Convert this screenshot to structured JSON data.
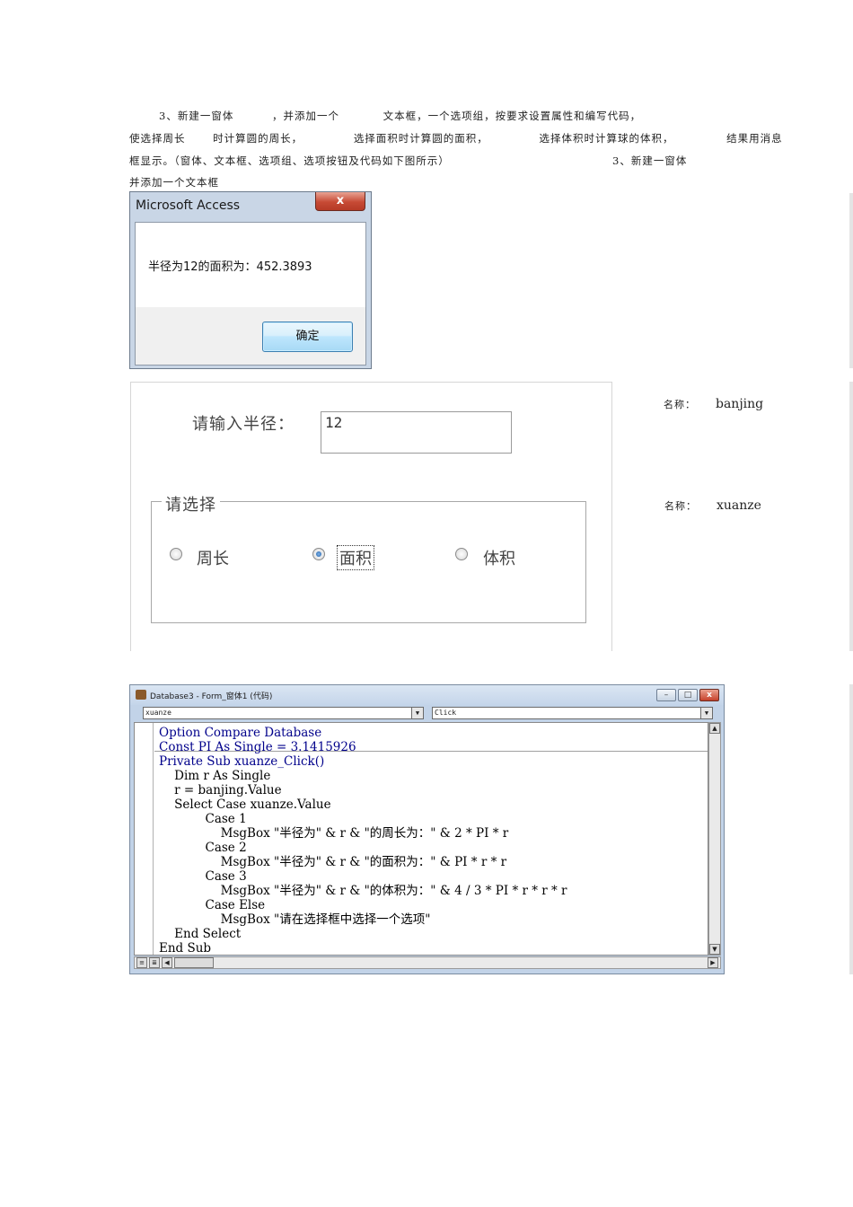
{
  "intro": {
    "line1": [
      "3、新建一窗体",
      "，并添加一个",
      "文本框，一个选项组，按要求设置属性和编写代码，"
    ],
    "line2": [
      "使选择周长",
      "时计算圆的周长，",
      "选择面积时计算圆的面积，",
      "选择体积时计算球的体积，",
      "结果用消息"
    ],
    "line3": [
      "框显示。（窗体、文本框、选项组、选项按钮及代码如下图所示）",
      "3、新建一窗体"
    ],
    "line4": "并添加一个文本框"
  },
  "msgbox": {
    "title": "Microsoft Access",
    "close_glyph": "x",
    "message": "半径为12的面积为：452.3893",
    "ok_label": "确定"
  },
  "form": {
    "prompt_label": "请输入半径：",
    "radius_value": "12",
    "group_legend": "请选择",
    "options": [
      {
        "label": "周长",
        "selected": false
      },
      {
        "label": "面积",
        "selected": true
      },
      {
        "label": "体积",
        "selected": false
      }
    ]
  },
  "side_labels": [
    {
      "cn": "名称：",
      "name": "banjing"
    },
    {
      "cn": "名称：",
      "name": "xuanze"
    }
  ],
  "code_window": {
    "title": "Database3 - Form_窗体1 (代码)",
    "object_combo": "xuanze",
    "procedure_combo": "Click",
    "buttons": {
      "minimize": "–",
      "restore": "□",
      "close": "x"
    },
    "lines": [
      "Option Compare Database",
      "Const PI As Single = 3.1415926",
      "Private Sub xuanze_Click()",
      "    Dim r As Single",
      "    r = banjing.Value",
      "    Select Case xuanze.Value",
      "            Case 1",
      "                MsgBox \"半径为\" & r & \"的周长为：\" & 2 * PI * r",
      "            Case 2",
      "                MsgBox \"半径为\" & r & \"的面积为：\" & PI * r * r",
      "            Case 3",
      "                MsgBox \"半径为\" & r & \"的体积为：\" & 4 / 3 * PI * r * r * r",
      "            Case Else",
      "                MsgBox \"请在选择框中选择一个选项\"",
      "    End Select",
      "End Sub"
    ]
  },
  "colors": {
    "keyword": "#00008b",
    "title_bar": "#c4d5ea",
    "close_red": "#c74a35",
    "ok_button": "#bee6fd"
  }
}
